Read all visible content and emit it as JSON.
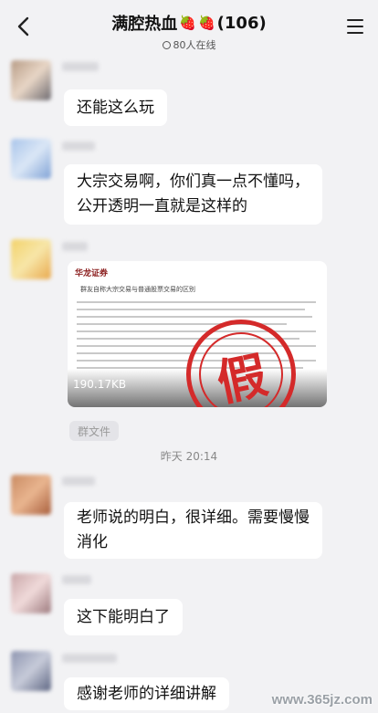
{
  "header": {
    "title": "满腔热血",
    "berry": "🍓",
    "count": "(106)",
    "online": "80人在线",
    "icons": {
      "back": "chevron-left-icon",
      "menu": "hamburger-menu-icon",
      "online": "online-status-icon"
    }
  },
  "messages": [
    {
      "text": "还能这么玩"
    },
    {
      "text_lines": [
        "大宗交易啊，你们真一点不懂吗，",
        "公开透明一直就是这样的"
      ]
    },
    {
      "file": {
        "org": "华龙证券",
        "doc_title": "群友自称大宗交易与普通股票交易的区别",
        "size": "190.17KB",
        "stamp": "假",
        "tag": "群文件"
      }
    },
    {
      "text_lines": [
        "老师说的明白，很详细。需要慢慢",
        "消化"
      ]
    },
    {
      "text": "这下能明白了"
    },
    {
      "text": "感谢老师的详细讲解"
    }
  ],
  "timestamp": "昨天 20:14",
  "watermark": "www.365jz.com",
  "colors": {
    "stamp": "#d42a2a",
    "bubble": "#ffffff",
    "background": "#f2f2f4"
  }
}
